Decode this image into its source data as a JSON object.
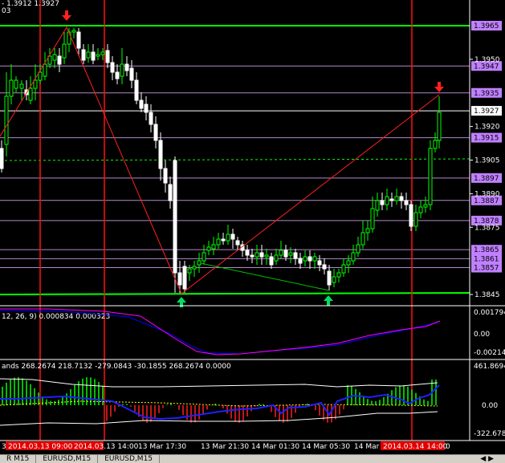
{
  "header": {
    "line1": "‐ 1.3912 1.3927",
    "line2": "03"
  },
  "price_axis": {
    "labels": [
      "1.3950",
      "1.3920",
      "1.3905",
      "1.3890",
      "1.3875",
      "1.3845"
    ],
    "levels": [
      {
        "value": "1.3965",
        "kind": "green"
      },
      {
        "value": "1.3947",
        "kind": "purple"
      },
      {
        "value": "1.3935",
        "kind": "purple"
      },
      {
        "value": "1.3927",
        "kind": "current"
      },
      {
        "value": "1.3915",
        "kind": "purple"
      },
      {
        "value": "1.3897",
        "kind": "purple"
      },
      {
        "value": "1.3887",
        "kind": "purple"
      },
      {
        "value": "1.3878",
        "kind": "purple"
      },
      {
        "value": "1.3865",
        "kind": "purple"
      },
      {
        "value": "1.3861",
        "kind": "purple"
      },
      {
        "value": "1.3857",
        "kind": "purple"
      }
    ]
  },
  "macd": {
    "label": "12, 26, 9) 0.000834 0.000323",
    "scale": [
      "0.001794",
      "0.00",
      "-0.00214"
    ]
  },
  "bands": {
    "label": "ands  268.2674 218.7132 -279.0843 -30.1855 268.2674 0.0000",
    "scale": [
      "461.8694",
      "0.00",
      "-322.678"
    ]
  },
  "time_axis": {
    "labels": [
      "13 Mar 17:30",
      "13 Mar 21:30",
      "14 Mar 01:30",
      "14 Mar 05:30",
      "14 Mar"
    ],
    "left_edge": "3",
    "tags": [
      "2014.03.13 09:00",
      "2014.03.13 14:00",
      "2014.03.14 14:00"
    ],
    "tag_right_suffix": "0"
  },
  "tabs": [
    "R M15",
    "EURUSD,M15",
    "EURUSD,M15"
  ],
  "colors": {
    "bull": "#00ff00",
    "bear": "#ffffff",
    "level_green": "#00ff00",
    "level_purple": "#b388c8",
    "tag_purple": "#c080ff",
    "tag_red": "#e00000",
    "vline": "#ff1010"
  }
}
